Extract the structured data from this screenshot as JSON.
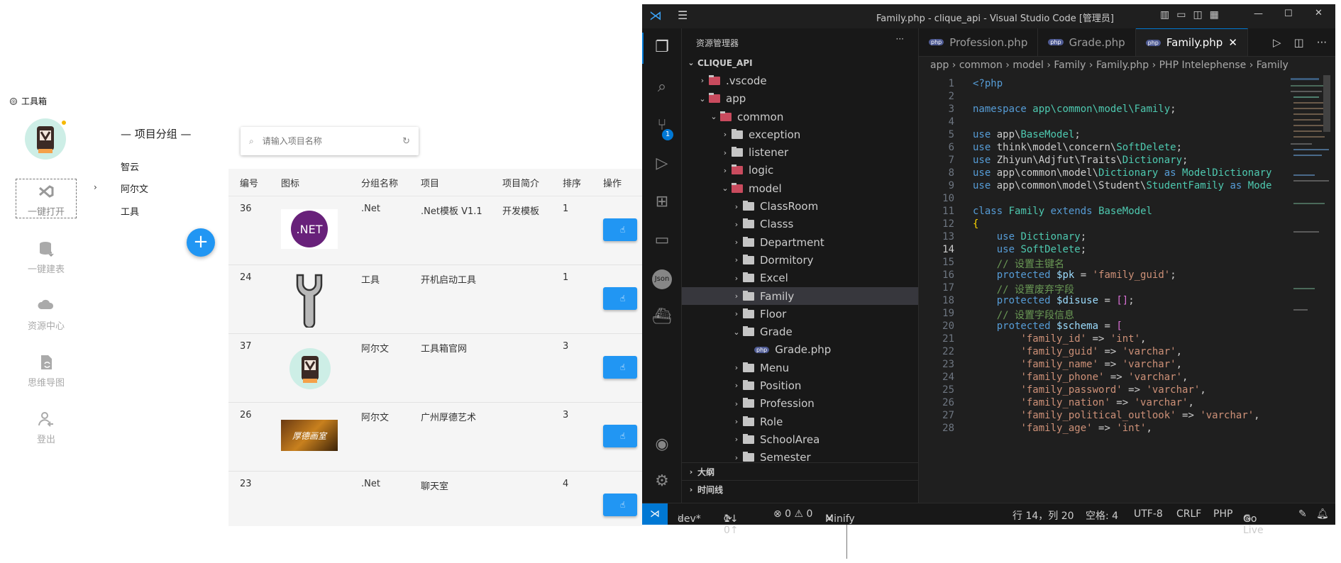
{
  "toolbox": {
    "title": "工具箱",
    "nav": [
      {
        "label": "一键打开",
        "icon": "vs-icon"
      },
      {
        "label": "一键建表",
        "icon": "database-icon"
      },
      {
        "label": "资源中心",
        "icon": "cloud-icon"
      },
      {
        "label": "思维导图",
        "icon": "file-sync-icon"
      },
      {
        "label": "登出",
        "icon": "user-logout-icon"
      }
    ],
    "group_header": "— 项目分组 —",
    "groups": [
      "智云",
      "阿尔文",
      "工具"
    ],
    "add_button": "+",
    "search_placeholder": "请输入项目名称",
    "columns": [
      "编号",
      "图标",
      "分组名称",
      "项目",
      "项目简介",
      "排序",
      "操作"
    ],
    "rows": [
      {
        "id": "36",
        "group": ".Net",
        "project": ".Net模板 V1.1",
        "desc": "开发模板",
        "order": "1",
        "icon": ".NET"
      },
      {
        "id": "24",
        "group": "工具",
        "project": "开机启动工具",
        "desc": "",
        "order": "1",
        "icon": "wrench"
      },
      {
        "id": "37",
        "group": "阿尔文",
        "project": "工具箱官网",
        "desc": "",
        "order": "3",
        "icon": "avatar"
      },
      {
        "id": "26",
        "group": "阿尔文",
        "project": "广州厚德艺术",
        "desc": "",
        "order": "3",
        "icon": "厚德画室"
      },
      {
        "id": "23",
        "group": ".Net",
        "project": "聊天室",
        "desc": "",
        "order": "4",
        "icon": ""
      }
    ]
  },
  "vscode": {
    "title": "Family.php - clique_api - Visual Studio Code [管理员]",
    "explorer_label": "资源管理器",
    "project_root": "CLIQUE_API",
    "tree": [
      {
        "label": ".vscode",
        "arrow": "›",
        "folder": "special"
      },
      {
        "label": "app",
        "arrow": "⌄",
        "folder": "special"
      },
      {
        "label": "common",
        "arrow": "⌄",
        "folder": "special"
      },
      {
        "label": "exception",
        "arrow": "›",
        "folder": "plain"
      },
      {
        "label": "listener",
        "arrow": "›",
        "folder": "plain"
      },
      {
        "label": "logic",
        "arrow": "›",
        "folder": "special"
      },
      {
        "label": "model",
        "arrow": "⌄",
        "folder": "special"
      },
      {
        "label": "ClassRoom",
        "arrow": "›",
        "folder": "plain"
      },
      {
        "label": "Classs",
        "arrow": "›",
        "folder": "plain"
      },
      {
        "label": "Department",
        "arrow": "›",
        "folder": "plain"
      },
      {
        "label": "Dormitory",
        "arrow": "›",
        "folder": "plain"
      },
      {
        "label": "Excel",
        "arrow": "›",
        "folder": "plain"
      },
      {
        "label": "Family",
        "arrow": "›",
        "folder": "plain",
        "selected": true
      },
      {
        "label": "Floor",
        "arrow": "›",
        "folder": "plain"
      },
      {
        "label": "Grade",
        "arrow": "⌄",
        "folder": "plain"
      },
      {
        "label": "Grade.php",
        "arrow": "",
        "folder": "php"
      },
      {
        "label": "Menu",
        "arrow": "›",
        "folder": "plain"
      },
      {
        "label": "Position",
        "arrow": "›",
        "folder": "plain"
      },
      {
        "label": "Profession",
        "arrow": "›",
        "folder": "plain"
      },
      {
        "label": "Role",
        "arrow": "›",
        "folder": "plain"
      },
      {
        "label": "SchoolArea",
        "arrow": "›",
        "folder": "plain"
      },
      {
        "label": "Semester",
        "arrow": "›",
        "folder": "plain"
      }
    ],
    "outline_label": "大纲",
    "timeline_label": "时间线",
    "tabs": [
      "Profession.php",
      "Grade.php",
      "Family.php"
    ],
    "breadcrumb": "app › common › model › Family › Family.php › PHP Intelephense › Family",
    "code": [
      {
        "n": "1",
        "h": "<span class=\"kw\">&lt;?php</span>"
      },
      {
        "n": "2",
        "h": ""
      },
      {
        "n": "3",
        "h": "<span class=\"kw\">namespace</span> <span class=\"ty\">app\\common\\model\\Family</span>;"
      },
      {
        "n": "4",
        "h": ""
      },
      {
        "n": "5",
        "h": "<span class=\"kw\">use</span> app\\<span class=\"ty\">BaseModel</span>;"
      },
      {
        "n": "6",
        "h": "<span class=\"kw\">use</span> think\\model\\concern\\<span class=\"ty\">SoftDelete</span>;"
      },
      {
        "n": "7",
        "h": "<span class=\"kw\">use</span> Zhiyun\\Adjfut\\Traits\\<span class=\"ty\">Dictionary</span>;"
      },
      {
        "n": "8",
        "h": "<span class=\"kw\">use</span> app\\common\\model\\<span class=\"ty\">Dictionary</span> <span class=\"kw\">as</span> <span class=\"ty\">ModelDictionary</span>"
      },
      {
        "n": "9",
        "h": "<span class=\"kw\">use</span> app\\common\\model\\Student\\<span class=\"ty\">StudentFamily</span> <span class=\"kw\">as</span> <span class=\"ty\">Mode</span>"
      },
      {
        "n": "10",
        "h": ""
      },
      {
        "n": "11",
        "h": "<span class=\"kw\">class</span> <span class=\"ty\">Family</span> <span class=\"kw\">extends</span> <span class=\"ty\">BaseModel</span>"
      },
      {
        "n": "12",
        "h": "<span class=\"br\">{</span>"
      },
      {
        "n": "13",
        "h": "    <span class=\"kw\">use</span> <span class=\"ty\">Dictionary</span>;"
      },
      {
        "n": "14",
        "h": "    <span class=\"kw\">use</span> <span class=\"ty\">SoftDelete</span>;"
      },
      {
        "n": "15",
        "h": "    <span class=\"cm\">// 设置主键名</span>"
      },
      {
        "n": "16",
        "h": "    <span class=\"kw\">protected</span> <span class=\"vr\">$pk</span> = <span class=\"st\">'family_guid'</span>;"
      },
      {
        "n": "17",
        "h": "    <span class=\"cm\">// 设置废弃字段</span>"
      },
      {
        "n": "18",
        "h": "    <span class=\"kw\">protected</span> <span class=\"vr\">$disuse</span> = <span class=\"pu\">[]</span>;"
      },
      {
        "n": "19",
        "h": "    <span class=\"cm\">// 设置字段信息</span>"
      },
      {
        "n": "20",
        "h": "    <span class=\"kw\">protected</span> <span class=\"vr\">$schema</span> = <span class=\"pu\">[</span>"
      },
      {
        "n": "21",
        "h": "        <span class=\"st\">'family_id'</span> =&gt; <span class=\"st\">'int'</span>,"
      },
      {
        "n": "22",
        "h": "        <span class=\"st\">'family_guid'</span> =&gt; <span class=\"st\">'varchar'</span>,"
      },
      {
        "n": "23",
        "h": "        <span class=\"st\">'family_name'</span> =&gt; <span class=\"st\">'varchar'</span>,"
      },
      {
        "n": "24",
        "h": "        <span class=\"st\">'family_phone'</span> =&gt; <span class=\"st\">'varchar'</span>,"
      },
      {
        "n": "25",
        "h": "        <span class=\"st\">'family_password'</span> =&gt; <span class=\"st\">'varchar'</span>,"
      },
      {
        "n": "26",
        "h": "        <span class=\"st\">'family_nation'</span> =&gt; <span class=\"st\">'varchar'</span>,"
      },
      {
        "n": "27",
        "h": "        <span class=\"st\">'family_political_outlook'</span> =&gt; <span class=\"st\">'varchar'</span>,"
      },
      {
        "n": "28",
        "h": "        <span class=\"st\">'family_age'</span> =&gt; <span class=\"st\">'int'</span>,"
      }
    ],
    "status": {
      "branch": "dev*",
      "sync": "1↓ 0↑",
      "problems": "⊗ 0 ⚠ 0",
      "minify": "Minify",
      "cursor": "行 14，列 20",
      "spaces": "空格: 4",
      "encoding": "UTF-8",
      "eol": "CRLF",
      "lang": "PHP",
      "golive": "Go Live"
    },
    "scm_badge": "1",
    "json_label": "Json"
  },
  "colors": {
    "accent": "#2196f3",
    "vscode_bg": "#1e1e1e",
    "vscode_blue": "#0078d4"
  }
}
